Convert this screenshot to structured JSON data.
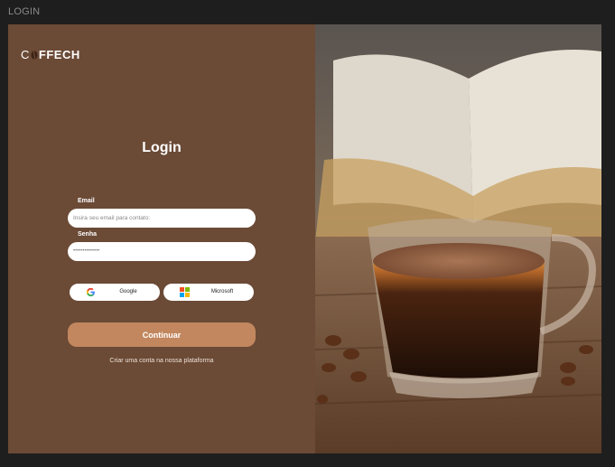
{
  "frame": {
    "title": "LOGIN"
  },
  "brand": {
    "logo_start": "C",
    "logo_mid": "FF",
    "logo_end": "ECH"
  },
  "login": {
    "heading": "Login",
    "email_label": "Email",
    "email_placeholder": "Insira seu email para contato:",
    "password_label": "Senha",
    "password_value": "••••••••••••••",
    "google_label": "Google",
    "microsoft_label": "Microsoft",
    "continue_label": "Continuar",
    "signup_link": "Criar uma conta na nossa plataforma"
  },
  "colors": {
    "panel": "#6b4a36",
    "accent": "#c2875e",
    "canvas": "#1e1e1e"
  },
  "icons": [
    "coffee-bean-icon",
    "google-icon",
    "microsoft-icon"
  ],
  "image": {
    "subject": "coffee-cup-photo"
  }
}
